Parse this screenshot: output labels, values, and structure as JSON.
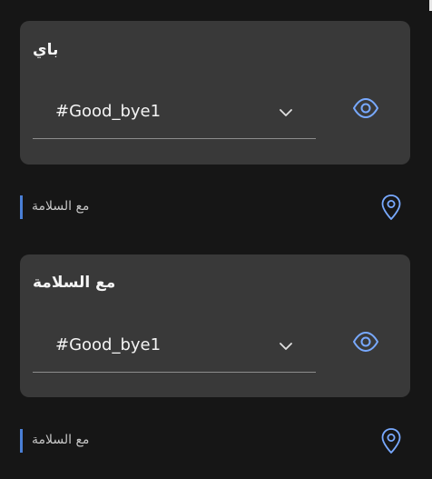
{
  "cards": [
    {
      "title": "باي",
      "select_value": "#Good_bye1",
      "note_text": "مع السلامة"
    },
    {
      "title": "مع السلامة",
      "select_value": "#Good_bye1",
      "note_text": "مع السلامة"
    }
  ],
  "icons": {
    "visibility": "eye-icon",
    "dropdown": "chevron-down-icon",
    "location": "location-pin-icon"
  },
  "colors": {
    "background": "#161616",
    "card": "#393939",
    "accent": "#78a9ff",
    "note_bar": "#4a7fd6"
  }
}
